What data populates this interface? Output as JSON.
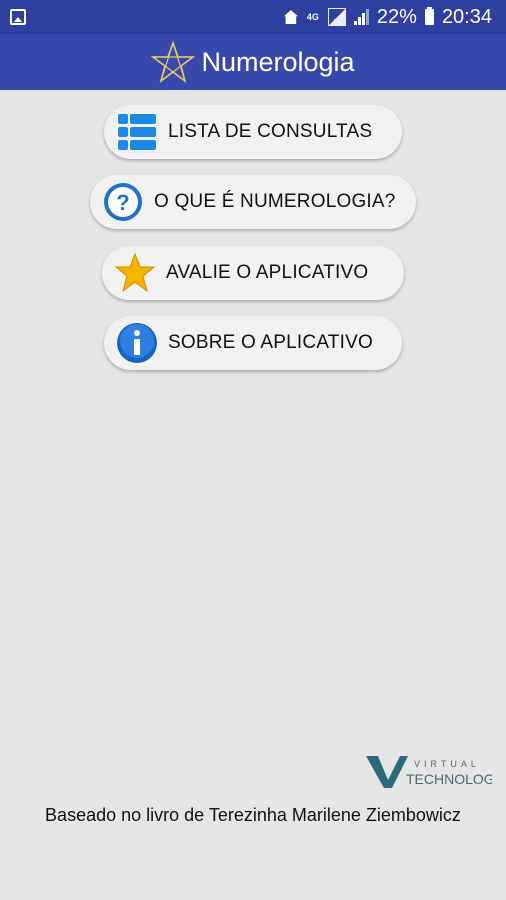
{
  "status_bar": {
    "battery": "22%",
    "time": "20:34",
    "network": "4G",
    "icons": [
      "image-icon",
      "home-icon",
      "4g-icon",
      "signal-icon",
      "bars-icon",
      "battery-icon"
    ]
  },
  "app_bar": {
    "title": "Numerologia",
    "logo_icon": "star-icon"
  },
  "menu": {
    "items": [
      {
        "label": "LISTA DE CONSULTAS",
        "icon": "list-icon"
      },
      {
        "label": "O QUE É NUMEROLOGIA?",
        "icon": "question-icon"
      },
      {
        "label": "AVALIE O APLICATIVO",
        "icon": "star-icon"
      },
      {
        "label": "SOBRE O APLICATIVO",
        "icon": "info-icon"
      }
    ]
  },
  "branding": {
    "logo_top": "VIRTUAL",
    "logo_bottom": "TECHNOLOGY"
  },
  "footer": {
    "text": "Baseado no livro de Terezinha Marilene Ziembowicz"
  },
  "colors": {
    "status_bar": "#2f3fa0",
    "app_bar": "#3949ab",
    "background": "#e5e5e5",
    "button": "#f1f1f1",
    "icon_blue": "#1e6fd0",
    "star_yellow": "#f5b400"
  }
}
